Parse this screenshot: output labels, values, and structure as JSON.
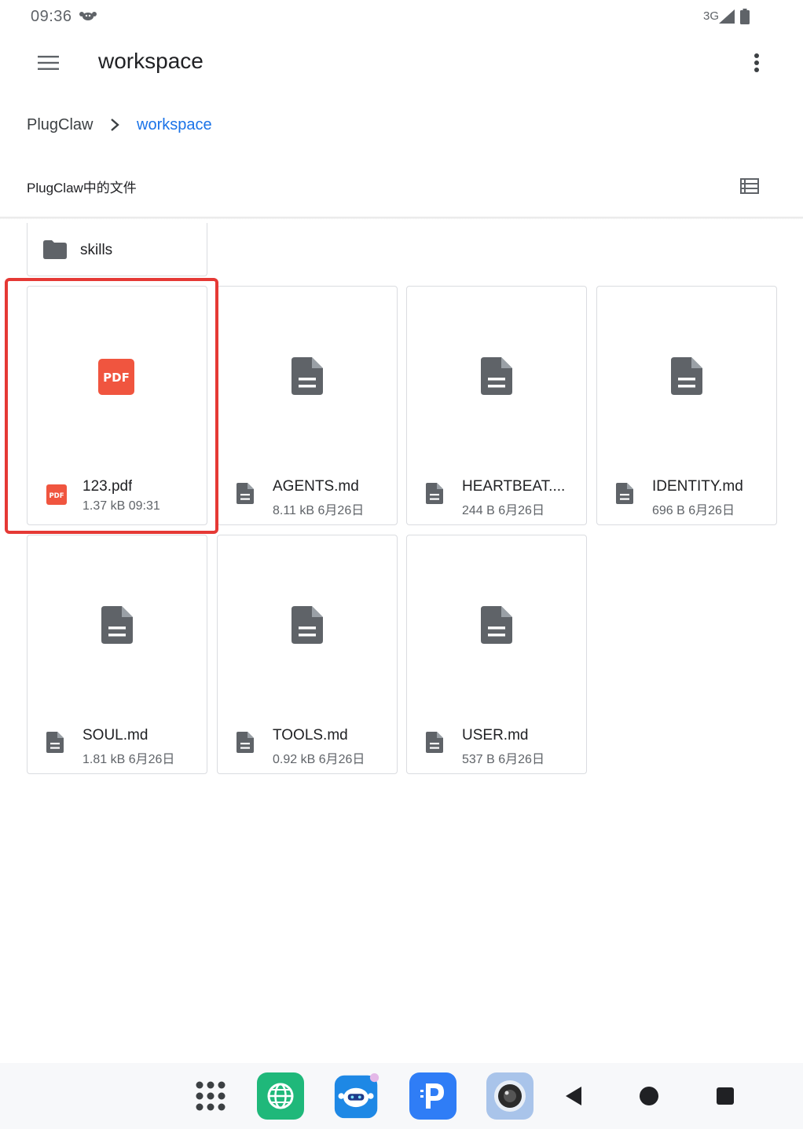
{
  "status_bar": {
    "time": "09:36",
    "network": "3G"
  },
  "toolbar": {
    "title": "workspace"
  },
  "breadcrumb": {
    "root": "PlugClaw",
    "current": "workspace"
  },
  "section": {
    "title": "PlugClaw中的文件"
  },
  "folders": [
    {
      "name": "skills",
      "icon": "folder-icon"
    }
  ],
  "files": [
    {
      "name": "123.pdf",
      "size": "1.37 kB",
      "date": "09:31",
      "meta": "1.37 kB 09:31",
      "type": "pdf",
      "icon": "pdf-icon",
      "selected": true
    },
    {
      "name": "AGENTS.md",
      "size": "8.11 kB",
      "date": "6月26日",
      "meta": "8.11 kB 6月26日",
      "type": "document",
      "icon": "document-icon"
    },
    {
      "name": "HEARTBEAT....",
      "size": "244 B",
      "date": "6月26日",
      "meta": "244 B 6月26日",
      "type": "document",
      "icon": "document-icon"
    },
    {
      "name": "IDENTITY.md",
      "size": "696 B",
      "date": "6月26日",
      "meta": "696 B 6月26日",
      "type": "document",
      "icon": "document-icon"
    },
    {
      "name": "SOUL.md",
      "size": "1.81 kB",
      "date": "6月26日",
      "meta": "1.81 kB 6月26日",
      "type": "document",
      "icon": "document-icon"
    },
    {
      "name": "TOOLS.md",
      "size": "0.92 kB",
      "date": "6月26日",
      "meta": "0.92 kB 6月26日",
      "type": "document",
      "icon": "document-icon"
    },
    {
      "name": "USER.md",
      "size": "537 B",
      "date": "6月26日",
      "meta": "537 B 6月26日",
      "type": "document",
      "icon": "document-icon"
    }
  ],
  "pdf_badge_text": "PDF",
  "colors": {
    "accent": "#1a73e8",
    "pdf_red": "#f0553f",
    "highlight": "#e53935",
    "icon_gray": "#5f6368"
  },
  "taskbar": {
    "items": [
      "app-drawer-icon",
      "browser-app-icon",
      "robot-app-icon",
      "plugclaw-app-icon",
      "camera-app-icon",
      "back-icon",
      "home-icon",
      "recents-icon"
    ]
  }
}
